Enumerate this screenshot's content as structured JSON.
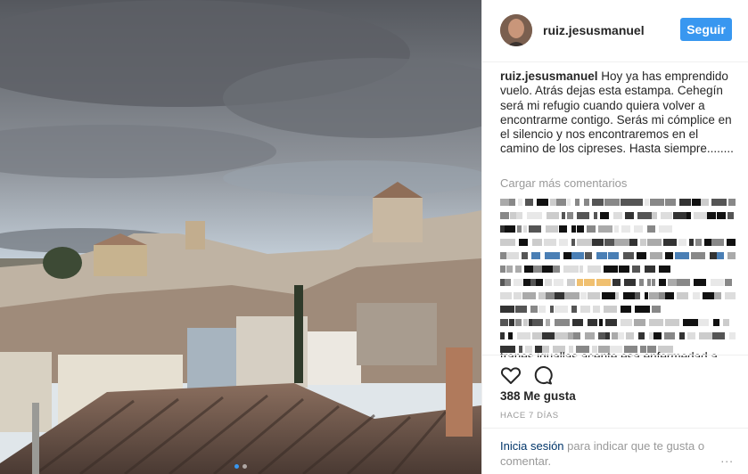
{
  "post": {
    "author": "ruiz.jesusmanuel",
    "follow_label": "Seguir",
    "caption_user": "ruiz.jesusmanuel",
    "caption_text": " Hoy ya has emprendido vuelo. Atrás dejas esta estampa. Cehegín será mi refugio cuando quiera volver a encontrarme contigo. Serás mi cómplice en el silencio y nos encontraremos en el camino de los cipreses. Hasta siempre........",
    "load_more": "Cargar más comentarios",
    "partial_comment": "tranes iguallas acente esa enfermedad a",
    "likes": "388 Me gusta",
    "timestamp": "HACE 7 DÍAS",
    "login_link": "Inicia sesión",
    "login_text": " para indicar que te gusta o comentar.",
    "options": "...",
    "carousel": {
      "count": 2,
      "active": 1
    }
  },
  "icons": [
    "heart-icon",
    "comment-icon",
    "avatar"
  ],
  "colors": {
    "accent": "#3897f0",
    "link": "#003569",
    "muted": "#999999"
  }
}
